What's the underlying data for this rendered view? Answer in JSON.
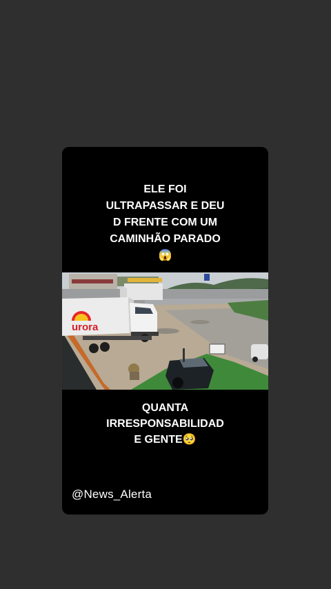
{
  "post": {
    "top_caption": {
      "line1": "ELE FOI",
      "line2": "ULTRAPASSAR E DEU",
      "line3": "D FRENTE COM UM",
      "line4": "CAMINHÃO PARADO",
      "emoji": "😱"
    },
    "video": {
      "truck_brand": "urora"
    },
    "bottom_caption": {
      "line1": "QUANTA",
      "line2": "IRRESPONSABILIDAD",
      "line3": "E GENTE🥺"
    },
    "handle": "@News_Alerta"
  },
  "colors": {
    "background": "#2f2f2f",
    "card": "#000000",
    "text": "#ffffff"
  }
}
